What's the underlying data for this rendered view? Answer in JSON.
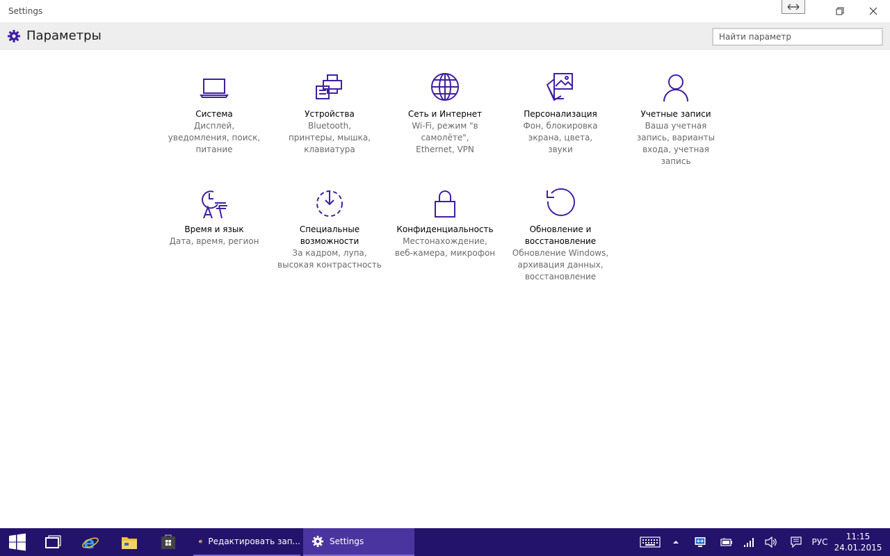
{
  "window": {
    "title": "Settings"
  },
  "header": {
    "app_title": "Параметры",
    "search_placeholder": "Найти параметр"
  },
  "tiles": [
    {
      "icon": "laptop-icon",
      "name": "Система",
      "desc": "Дисплей, уведомления, поиск, питание"
    },
    {
      "icon": "devices-icon",
      "name": "Устройства",
      "desc": "Bluetooth, принтеры, мышка, клавиатура"
    },
    {
      "icon": "globe-icon",
      "name": "Сеть и Интернет",
      "desc": "Wi-Fi, режим \"в самолёте\", Ethernet, VPN"
    },
    {
      "icon": "personalization-icon",
      "name": "Персонализация",
      "desc": "Фон, блокировка экрана, цвета, звуки"
    },
    {
      "icon": "person-icon",
      "name": "Учетные записи",
      "desc": "Ваша учетная запись, варианты входа, учетная запись"
    },
    {
      "icon": "time-language-icon",
      "name": "Время и язык",
      "desc": "Дата, время, регион"
    },
    {
      "icon": "ease-of-access-icon",
      "name": "Специальные возможности",
      "desc": "За кадром, лупа, высокая контрастность"
    },
    {
      "icon": "lock-icon",
      "name": "Конфиденциальность",
      "desc": "Местонахождение, веб-камера, микрофон"
    },
    {
      "icon": "refresh-icon",
      "name": "Обновление и восстановление",
      "desc": "Обновление Windows, архивация данных, восстановление"
    }
  ],
  "taskbar": {
    "chrome_label": "Редактировать зап...",
    "settings_label": "Settings",
    "language": "РУС",
    "time": "11:15",
    "date": "24.01.2015"
  },
  "colors": {
    "accent": "#3f1fa3",
    "taskbar": "#24136b"
  }
}
